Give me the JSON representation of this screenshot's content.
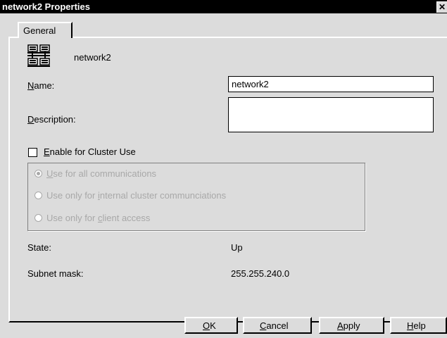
{
  "window": {
    "title": "network2 Properties",
    "close_glyph": "✕"
  },
  "tabs": [
    {
      "label": "General"
    }
  ],
  "header": {
    "network_name": "network2",
    "icon": "network-icon"
  },
  "form": {
    "name": {
      "label_key": "N",
      "label_rest": "ame:",
      "value": "network2"
    },
    "description": {
      "label_key": "D",
      "label_rest": "escription:",
      "value": ""
    },
    "cluster": {
      "label_key": "E",
      "label_rest": "nable for Cluster Use",
      "checked": false
    },
    "radios": [
      {
        "label_key": "U",
        "label_rest": "se for all communications",
        "selected": true,
        "enabled": false
      },
      {
        "pre": "Use only for ",
        "label_key": "i",
        "label_rest": "nternal cluster communciations",
        "selected": false,
        "enabled": false
      },
      {
        "pre": "Use only for ",
        "label_key": "c",
        "label_rest": "lient access",
        "selected": false,
        "enabled": false
      }
    ]
  },
  "info": {
    "state_label": "State:",
    "state_value": "Up",
    "subnet_label": "Subnet mask:",
    "subnet_value": "255.255.240.0"
  },
  "buttons": {
    "ok": {
      "key": "O",
      "rest": "K"
    },
    "cancel": {
      "key": "C",
      "rest": "ancel"
    },
    "apply": {
      "key": "A",
      "rest": "pply"
    },
    "help": {
      "key": "H",
      "rest": "elp"
    }
  }
}
